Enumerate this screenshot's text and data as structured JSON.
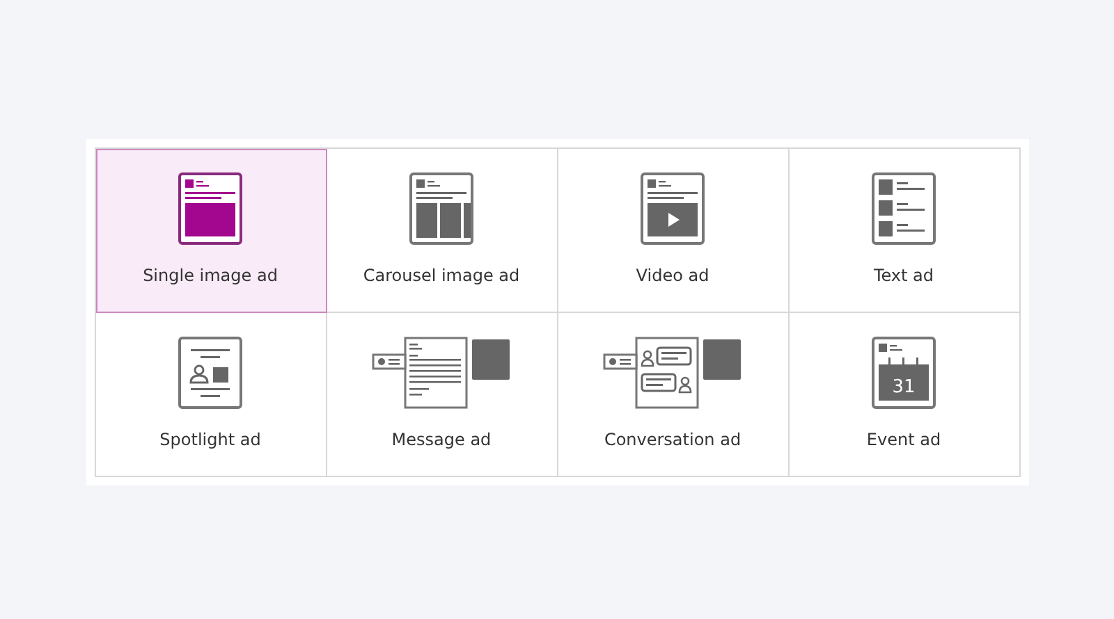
{
  "ad_formats": [
    {
      "kind": "single_image",
      "label": "Single image ad",
      "selected": true
    },
    {
      "kind": "carousel",
      "label": "Carousel image ad",
      "selected": false
    },
    {
      "kind": "video",
      "label": "Video ad",
      "selected": false
    },
    {
      "kind": "text",
      "label": "Text ad",
      "selected": false
    },
    {
      "kind": "spotlight",
      "label": "Spotlight ad",
      "selected": false
    },
    {
      "kind": "message",
      "label": "Message ad",
      "selected": false
    },
    {
      "kind": "conversation",
      "label": "Conversation ad",
      "selected": false
    },
    {
      "kind": "event",
      "label": "Event ad",
      "selected": false,
      "icon_text": "31"
    }
  ]
}
